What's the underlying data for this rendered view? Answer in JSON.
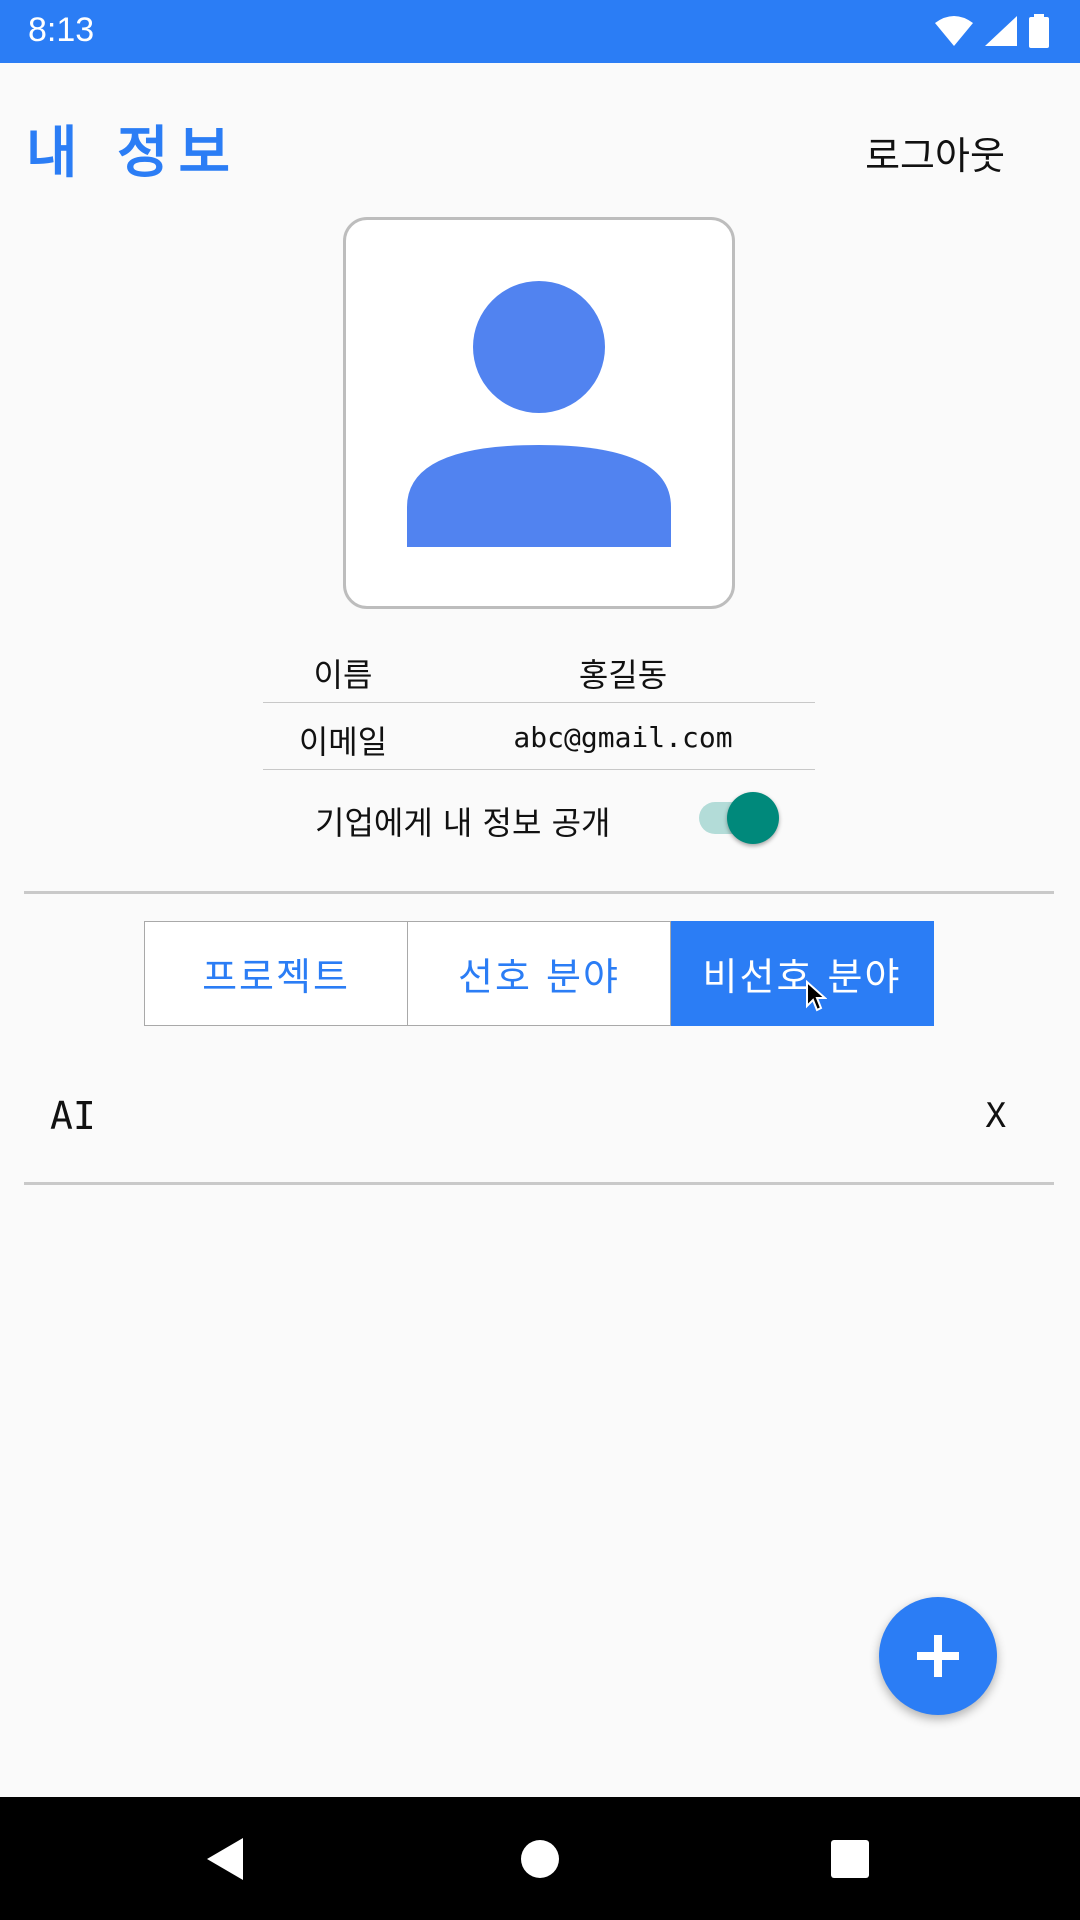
{
  "status_bar": {
    "time": "8:13"
  },
  "header": {
    "title": "내 정보",
    "logout_label": "로그아웃"
  },
  "profile": {
    "name_label": "이름",
    "name_value": "홍길동",
    "email_label": "이메일",
    "email_value": "abc@gmail.com",
    "public_label": "기업에게 내 정보 공개",
    "public_enabled": true
  },
  "tabs": [
    {
      "label": "프로젝트",
      "active": false
    },
    {
      "label": "선호 분야",
      "active": false
    },
    {
      "label": "비선호 분야",
      "active": true
    }
  ],
  "list": {
    "items": [
      {
        "text": "AI",
        "remove_label": "X"
      }
    ]
  },
  "colors": {
    "primary": "#2b7df5",
    "toggle_on": "#00897b",
    "avatar": "#5183f0"
  },
  "icons": {
    "fab": "plus-icon",
    "avatar": "person-icon",
    "status": [
      "wifi-icon",
      "signal-icon",
      "battery-icon"
    ],
    "nav": [
      "back-icon",
      "home-icon",
      "recents-icon"
    ]
  }
}
